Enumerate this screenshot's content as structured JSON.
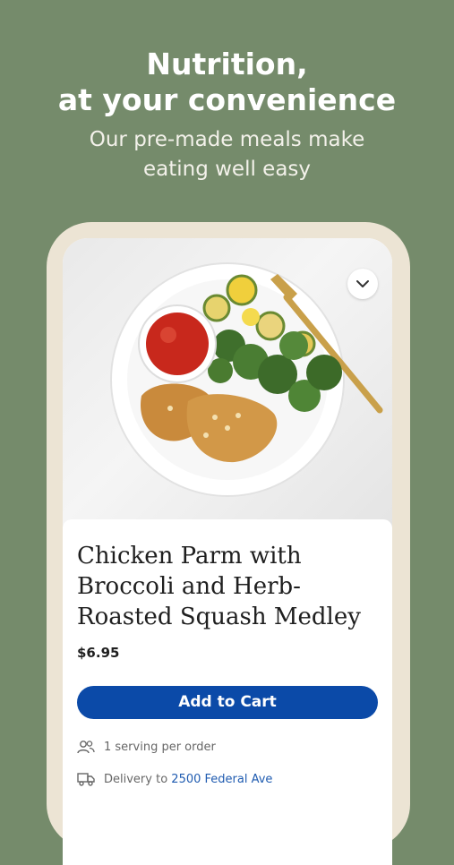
{
  "header": {
    "title_line1": "Nutrition,",
    "title_line2": "at your convenience",
    "subtitle_line1": "Our pre-made meals make",
    "subtitle_line2": "eating well easy"
  },
  "meal": {
    "title": "Chicken Parm with Broccoli and Herb-Roasted Squash Medley",
    "price": "$6.95",
    "add_to_cart_label": "Add to Cart",
    "servings_text": "1 serving per order",
    "delivery_prefix": "Delivery to",
    "delivery_address": "2500 Federal Ave"
  },
  "icons": {
    "collapse": "chevron-down-icon",
    "servings": "people-icon",
    "delivery": "truck-icon"
  },
  "colors": {
    "background": "#758b6b",
    "button": "#0b4aa8",
    "link": "#1f5bb0"
  }
}
